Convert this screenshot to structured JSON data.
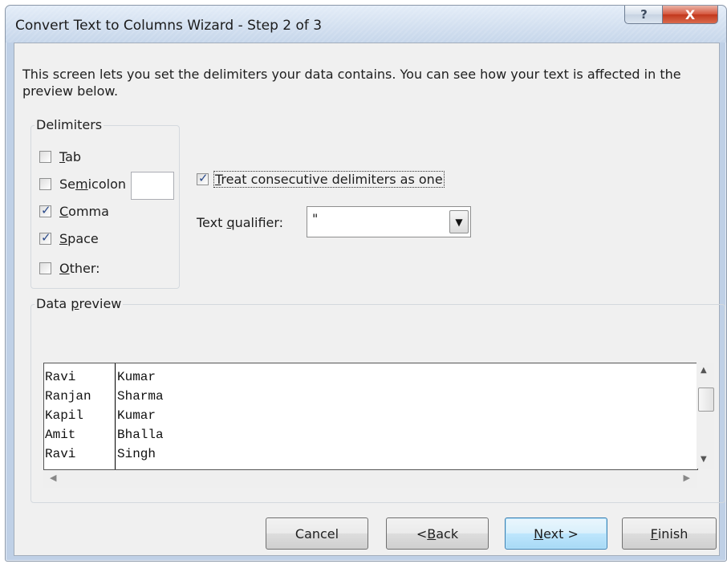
{
  "window": {
    "title": "Convert Text to Columns Wizard - Step 2 of 3",
    "help_symbol": "?",
    "close_symbol": "X"
  },
  "intro_text": "This screen lets you set the delimiters your data contains.  You can see how your text is affected in the preview below.",
  "delimiters": {
    "legend": "Delimiters",
    "items": [
      {
        "pre": "",
        "key": "T",
        "post": "ab",
        "checked": false
      },
      {
        "pre": "Se",
        "key": "m",
        "post": "icolon",
        "checked": false
      },
      {
        "pre": "",
        "key": "C",
        "post": "omma",
        "checked": true
      },
      {
        "pre": "",
        "key": "S",
        "post": "pace",
        "checked": true
      },
      {
        "pre": "",
        "key": "O",
        "post": "ther:",
        "checked": false
      }
    ],
    "other_value": ""
  },
  "consecutive": {
    "pre": "",
    "key": "T",
    "post": "reat consecutive delimiters as one",
    "checked": true
  },
  "qualifier": {
    "label_pre": "Text ",
    "label_key": "q",
    "label_post": "ualifier:",
    "value": "\""
  },
  "preview": {
    "legend_pre": "Data ",
    "legend_key": "p",
    "legend_post": "review",
    "rows": [
      [
        "Ravi",
        "Kumar"
      ],
      [
        "Ranjan",
        "Sharma"
      ],
      [
        "Kapil",
        "Kumar"
      ],
      [
        "Amit",
        "Bhalla"
      ],
      [
        "Ravi",
        "Singh"
      ]
    ]
  },
  "buttons": {
    "cancel": "Cancel",
    "back": {
      "pre": "< ",
      "key": "B",
      "post": "ack"
    },
    "next": {
      "pre": "",
      "key": "N",
      "post": "ext >"
    },
    "finish": {
      "pre": "",
      "key": "F",
      "post": "inish"
    }
  }
}
